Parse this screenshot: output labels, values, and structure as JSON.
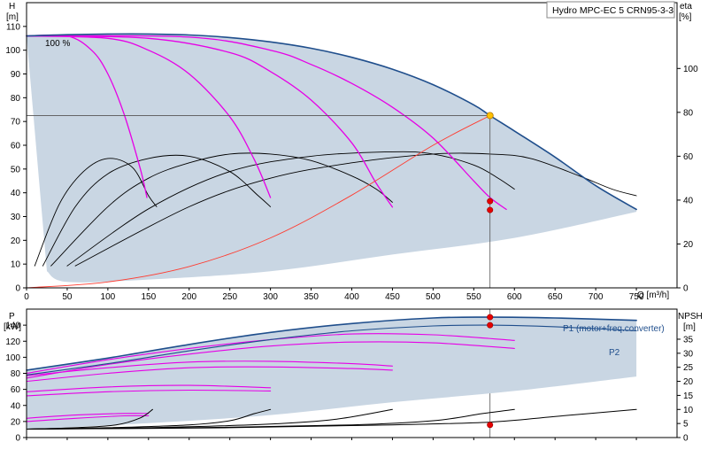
{
  "title": "Hydro MPC-EC 5 CRN95-3-3",
  "colors": {
    "region_fill": "#c9d6e3",
    "envelope": "#1f4e8c",
    "speed_curve": "#e600e6",
    "eff_curve": "#000000",
    "system_curve": "#ff3b2f",
    "duty_point": "#ffc000",
    "duty_marker": "#e60000",
    "axis": "#000000",
    "guide": "#555555"
  },
  "chart_data": [
    {
      "type": "line",
      "name": "head",
      "x_axis": {
        "label": "Q [m³/h]",
        "range": [
          0,
          800
        ],
        "ticks": [
          0,
          50,
          100,
          150,
          200,
          250,
          300,
          350,
          400,
          450,
          500,
          550,
          600,
          650,
          700,
          750
        ]
      },
      "y_axis": {
        "label": "H",
        "unit": "[m]",
        "range": [
          0,
          120
        ],
        "ticks": [
          0,
          10,
          20,
          30,
          40,
          50,
          60,
          70,
          80,
          90,
          100,
          110
        ]
      },
      "y2_axis": {
        "label": "eta",
        "unit": "[%]",
        "range": [
          0,
          130
        ],
        "ticks": [
          0,
          20,
          40,
          60,
          80,
          100
        ]
      },
      "grid": false,
      "annotation": "100 %",
      "max_curve": [
        [
          0,
          106
        ],
        [
          50,
          106.5
        ],
        [
          100,
          106.8
        ],
        [
          150,
          106.8
        ],
        [
          200,
          106.4
        ],
        [
          250,
          105.3
        ],
        [
          300,
          103.5
        ],
        [
          350,
          100.8
        ],
        [
          400,
          97
        ],
        [
          450,
          92
        ],
        [
          500,
          85.5
        ],
        [
          550,
          77
        ],
        [
          570,
          72.5
        ],
        [
          600,
          66
        ],
        [
          650,
          55
        ],
        [
          700,
          43
        ],
        [
          750,
          33
        ]
      ],
      "min_curve": [
        [
          25,
          7
        ],
        [
          50,
          2.5
        ],
        [
          150,
          3.5
        ],
        [
          300,
          7
        ],
        [
          450,
          14
        ],
        [
          600,
          21
        ],
        [
          750,
          32
        ]
      ],
      "speed_curves": [
        [
          [
            0,
            106
          ],
          [
            50,
            106
          ],
          [
            80,
            100
          ],
          [
            100,
            90
          ],
          [
            120,
            73
          ],
          [
            140,
            50
          ],
          [
            148,
            38
          ]
        ],
        [
          [
            0,
            106
          ],
          [
            100,
            105
          ],
          [
            150,
            100
          ],
          [
            200,
            90
          ],
          [
            250,
            72
          ],
          [
            280,
            54
          ],
          [
            300,
            38
          ]
        ],
        [
          [
            0,
            106
          ],
          [
            150,
            105
          ],
          [
            250,
            99
          ],
          [
            300,
            91
          ],
          [
            350,
            79
          ],
          [
            400,
            61
          ],
          [
            430,
            44
          ],
          [
            450,
            34
          ]
        ],
        [
          [
            0,
            106
          ],
          [
            200,
            105.5
          ],
          [
            300,
            100
          ],
          [
            350,
            94
          ],
          [
            400,
            86
          ],
          [
            450,
            76
          ],
          [
            500,
            63
          ],
          [
            550,
            45
          ],
          [
            570,
            38
          ],
          [
            590,
            33
          ]
        ]
      ],
      "efficiency_curves": [
        [
          [
            10,
            10
          ],
          [
            40,
            38
          ],
          [
            70,
            53
          ],
          [
            100,
            59
          ],
          [
            130,
            55
          ],
          [
            150,
            42
          ],
          [
            160,
            37
          ]
        ],
        [
          [
            20,
            10
          ],
          [
            60,
            37
          ],
          [
            100,
            52
          ],
          [
            150,
            59
          ],
          [
            200,
            60
          ],
          [
            250,
            53
          ],
          [
            285,
            42
          ],
          [
            300,
            37
          ]
        ],
        [
          [
            30,
            10
          ],
          [
            100,
            37
          ],
          [
            150,
            50
          ],
          [
            200,
            57
          ],
          [
            250,
            61
          ],
          [
            300,
            61
          ],
          [
            350,
            58
          ],
          [
            400,
            51
          ],
          [
            430,
            45
          ],
          [
            450,
            39
          ]
        ],
        [
          [
            50,
            10
          ],
          [
            150,
            36
          ],
          [
            250,
            53
          ],
          [
            350,
            60
          ],
          [
            450,
            62
          ],
          [
            500,
            61
          ],
          [
            550,
            56
          ],
          [
            580,
            50
          ],
          [
            600,
            45
          ]
        ],
        [
          [
            60,
            10
          ],
          [
            200,
            37
          ],
          [
            300,
            50
          ],
          [
            400,
            57
          ],
          [
            500,
            61
          ],
          [
            570,
            61
          ],
          [
            620,
            59
          ],
          [
            680,
            51
          ],
          [
            720,
            45
          ],
          [
            750,
            42
          ]
        ]
      ],
      "system_curve": [
        [
          0,
          0
        ],
        [
          100,
          2.5
        ],
        [
          200,
          9
        ],
        [
          300,
          21
        ],
        [
          400,
          39
        ],
        [
          500,
          60
        ],
        [
          570,
          72.5
        ]
      ],
      "duty_point": {
        "q": 570,
        "h": 72.5
      },
      "duty_efficiency_markers": [
        [
          570,
          39.5
        ],
        [
          570,
          35.5
        ]
      ]
    },
    {
      "type": "line",
      "name": "power",
      "x_axis": {
        "range": [
          0,
          800
        ]
      },
      "y_axis": {
        "label": "P",
        "unit": "[kW]",
        "range": [
          0,
          160
        ],
        "ticks": [
          0,
          20,
          40,
          60,
          80,
          100,
          120,
          140
        ]
      },
      "y2_axis": {
        "label": "NPSH",
        "unit": "[m]",
        "range": [
          0,
          45.71
        ],
        "ticks": [
          0,
          5,
          10,
          15,
          20,
          25,
          30,
          35
        ]
      },
      "labels": {
        "p1": "P1 (motor+freq.converter)",
        "p2": "P2"
      },
      "p1_curve": [
        [
          0,
          84
        ],
        [
          100,
          99
        ],
        [
          200,
          116
        ],
        [
          300,
          131
        ],
        [
          400,
          142
        ],
        [
          500,
          149
        ],
        [
          570,
          150
        ],
        [
          650,
          149
        ],
        [
          750,
          146
        ]
      ],
      "p2_curve": [
        [
          0,
          78
        ],
        [
          100,
          92
        ],
        [
          200,
          108
        ],
        [
          300,
          122
        ],
        [
          400,
          133
        ],
        [
          500,
          139
        ],
        [
          570,
          140
        ],
        [
          650,
          138
        ],
        [
          750,
          133
        ]
      ],
      "region_bottom": [
        [
          0,
          10
        ],
        [
          150,
          18
        ],
        [
          300,
          28
        ],
        [
          450,
          44
        ],
        [
          600,
          58
        ],
        [
          750,
          76
        ]
      ],
      "speed_power_curves": [
        [
          [
            0,
            24
          ],
          [
            60,
            28
          ],
          [
            120,
            30
          ],
          [
            150,
            30
          ]
        ],
        [
          [
            0,
            20
          ],
          [
            60,
            24
          ],
          [
            120,
            27
          ],
          [
            150,
            27
          ]
        ],
        [
          [
            0,
            57
          ],
          [
            100,
            63
          ],
          [
            200,
            65
          ],
          [
            300,
            62
          ]
        ],
        [
          [
            0,
            52
          ],
          [
            100,
            57
          ],
          [
            200,
            59
          ],
          [
            300,
            58
          ]
        ],
        [
          [
            0,
            77
          ],
          [
            100,
            87
          ],
          [
            200,
            94
          ],
          [
            300,
            95
          ],
          [
            400,
            92
          ],
          [
            450,
            89
          ]
        ],
        [
          [
            0,
            70
          ],
          [
            100,
            80
          ],
          [
            200,
            87
          ],
          [
            300,
            88
          ],
          [
            400,
            86
          ],
          [
            450,
            84
          ]
        ],
        [
          [
            0,
            80
          ],
          [
            100,
            97
          ],
          [
            200,
            111
          ],
          [
            300,
            122
          ],
          [
            400,
            129
          ],
          [
            500,
            128
          ],
          [
            600,
            121
          ]
        ],
        [
          [
            0,
            74
          ],
          [
            100,
            91
          ],
          [
            200,
            104
          ],
          [
            300,
            114
          ],
          [
            400,
            119
          ],
          [
            500,
            118
          ],
          [
            600,
            111
          ]
        ]
      ],
      "npsh_curves": [
        [
          [
            0,
            3
          ],
          [
            60,
            3.5
          ],
          [
            110,
            4.5
          ],
          [
            140,
            7
          ],
          [
            155,
            10
          ]
        ],
        [
          [
            0,
            3
          ],
          [
            100,
            3.5
          ],
          [
            200,
            4.5
          ],
          [
            250,
            6
          ],
          [
            280,
            8.5
          ],
          [
            300,
            10
          ]
        ],
        [
          [
            0,
            3
          ],
          [
            150,
            3.5
          ],
          [
            300,
            4.8
          ],
          [
            380,
            6.5
          ],
          [
            450,
            10
          ]
        ],
        [
          [
            0,
            3
          ],
          [
            200,
            3.5
          ],
          [
            400,
            4.5
          ],
          [
            500,
            6
          ],
          [
            560,
            8.5
          ],
          [
            600,
            10
          ]
        ],
        [
          [
            0,
            3
          ],
          [
            250,
            3.5
          ],
          [
            450,
            4.5
          ],
          [
            570,
            5.5
          ],
          [
            650,
            7.5
          ],
          [
            750,
            10
          ]
        ]
      ],
      "duty_markers": [
        [
          570,
          150
        ],
        [
          570,
          140
        ]
      ],
      "npsh_marker": [
        570,
        4.5
      ]
    }
  ]
}
